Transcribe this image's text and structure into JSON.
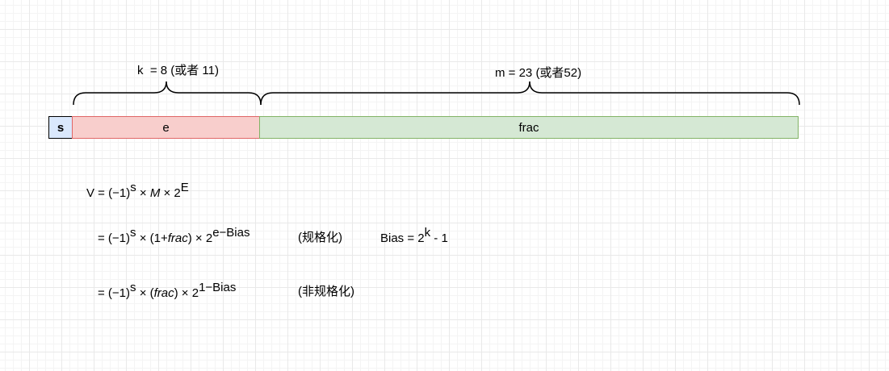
{
  "braces": {
    "exponent_label": "k  = 8 (或者 11)",
    "fraction_label": "m = 23 (或者52)"
  },
  "fields": {
    "sign": "s",
    "exponent": "e",
    "fraction": "frac"
  },
  "formulas": {
    "line1": {
      "prefix": "V = (−1)",
      "sup1": "s",
      "middle": " × ",
      "M": "M",
      "times2": " × 2",
      "sup2": "E"
    },
    "line2": {
      "prefix": "= (−1)",
      "sup1": "s",
      "middle1": " × (1+",
      "frac": "frac",
      "middle2": ") × 2",
      "sup2": "e−Bias",
      "note": "(规格化)",
      "bias_prefix": "Bias = 2",
      "bias_sup": "k",
      "bias_suffix": " - 1"
    },
    "line3": {
      "prefix": "= (−1)",
      "sup1": "s",
      "middle1": " × (",
      "frac": "frac",
      "middle2": ") × 2",
      "sup2": "1−Bias",
      "note": "(非规格化)"
    }
  },
  "colors": {
    "sign_fill": "#dae8fc",
    "exponent_fill": "#f8cecc",
    "exponent_stroke": "#e06666",
    "fraction_fill": "#d5e8d4",
    "fraction_stroke": "#82b366"
  }
}
